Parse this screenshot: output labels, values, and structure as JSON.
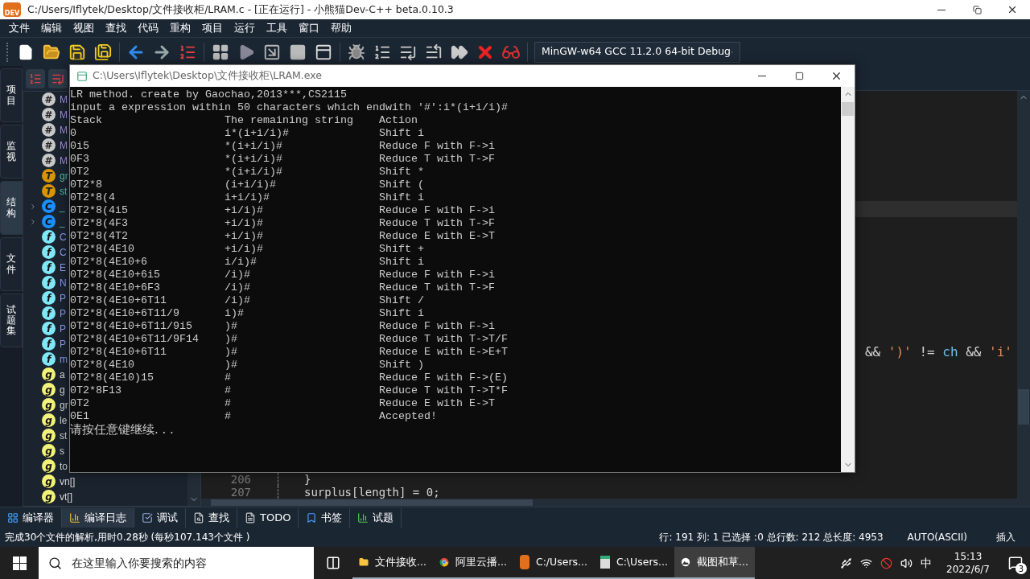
{
  "window": {
    "title": "C:/Users/Iflytek/Desktop/文件接收柜/LRAM.c - [正在运行] - 小熊猫Dev-C++ beta.0.10.3",
    "logo": "DEV"
  },
  "menu": [
    "文件",
    "编辑",
    "视图",
    "查找",
    "代码",
    "重构",
    "项目",
    "运行",
    "工具",
    "窗口",
    "帮助"
  ],
  "toolbar": {
    "compiler": "MinGW-w64 GCC 11.2.0 64-bit Debug"
  },
  "side_tabs": [
    {
      "label": "项目",
      "selected": false
    },
    {
      "label": "监视",
      "selected": false
    },
    {
      "label": "结构",
      "selected": true
    },
    {
      "label": "文件",
      "selected": false
    },
    {
      "label": "试题集",
      "selected": false
    }
  ],
  "structure": {
    "items": [
      {
        "kind": "define",
        "badge": "#",
        "name": "M"
      },
      {
        "kind": "define",
        "badge": "#",
        "name": "M"
      },
      {
        "kind": "define",
        "badge": "#",
        "name": "M"
      },
      {
        "kind": "define",
        "badge": "#",
        "name": "M"
      },
      {
        "kind": "define",
        "badge": "#",
        "name": "M"
      },
      {
        "kind": "type",
        "badge": "T",
        "name": "gr"
      },
      {
        "kind": "type",
        "badge": "T",
        "name": "st"
      },
      {
        "kind": "class",
        "badge": "C",
        "name": "_",
        "expanded": false
      },
      {
        "kind": "class",
        "badge": "C",
        "name": "_",
        "expanded": false
      },
      {
        "kind": "function",
        "badge": "f",
        "name": "C"
      },
      {
        "kind": "function",
        "badge": "f",
        "name": "C"
      },
      {
        "kind": "function",
        "badge": "f",
        "name": "E"
      },
      {
        "kind": "function",
        "badge": "f",
        "name": "N"
      },
      {
        "kind": "function",
        "badge": "f",
        "name": "P"
      },
      {
        "kind": "function",
        "badge": "f",
        "name": "P"
      },
      {
        "kind": "function",
        "badge": "f",
        "name": "P"
      },
      {
        "kind": "function",
        "badge": "f",
        "name": "P"
      },
      {
        "kind": "function",
        "badge": "f",
        "name": "m"
      },
      {
        "kind": "global",
        "badge": "g",
        "name": "a"
      },
      {
        "kind": "global",
        "badge": "g",
        "name": "g"
      },
      {
        "kind": "global",
        "badge": "g",
        "name": "gr"
      },
      {
        "kind": "global",
        "badge": "g",
        "name": "le"
      },
      {
        "kind": "global",
        "badge": "g",
        "name": "st"
      },
      {
        "kind": "global",
        "badge": "g",
        "name": "s"
      },
      {
        "kind": "global",
        "badge": "g",
        "name": "to"
      },
      {
        "kind": "global",
        "badge": "g",
        "name": "vn[]"
      },
      {
        "kind": "global",
        "badge": "g",
        "name": "vt[]"
      }
    ]
  },
  "editor": {
    "fragment": [
      {
        "text": "&&",
        "kind": "op"
      },
      {
        "text": "')'",
        "kind": "str"
      },
      {
        "text": "!=",
        "kind": "op"
      },
      {
        "text": "ch",
        "kind": "id"
      },
      {
        "text": "&&",
        "kind": "op"
      },
      {
        "text": "'i'",
        "kind": "str"
      }
    ],
    "lines": [
      {
        "number": "206",
        "code": "}"
      },
      {
        "number": "207",
        "code": "surplus[length] = 0;"
      }
    ]
  },
  "console": {
    "title": "C:\\Users\\Iflytek\\Desktop\\文件接收柜\\LRAM.exe",
    "intro": [
      "LR method. create by Gaochao,2013***,CS2115",
      "input a expression within 50 characters which endwith '#':i*(i+i/i)#"
    ],
    "columns": [
      "Stack",
      "The remaining string",
      "Action"
    ],
    "rows": [
      {
        "stack": "0",
        "remaining": "i*(i+i/i)#",
        "action": "Shift i"
      },
      {
        "stack": "0i5",
        "remaining": "*(i+i/i)#",
        "action": "Reduce F with F->i"
      },
      {
        "stack": "0F3",
        "remaining": "*(i+i/i)#",
        "action": "Reduce T with T->F"
      },
      {
        "stack": "0T2",
        "remaining": "*(i+i/i)#",
        "action": "Shift *"
      },
      {
        "stack": "0T2*8",
        "remaining": "(i+i/i)#",
        "action": "Shift ("
      },
      {
        "stack": "0T2*8(4",
        "remaining": "i+i/i)#",
        "action": "Shift i"
      },
      {
        "stack": "0T2*8(4i5",
        "remaining": "+i/i)#",
        "action": "Reduce F with F->i"
      },
      {
        "stack": "0T2*8(4F3",
        "remaining": "+i/i)#",
        "action": "Reduce T with T->F"
      },
      {
        "stack": "0T2*8(4T2",
        "remaining": "+i/i)#",
        "action": "Reduce E with E->T"
      },
      {
        "stack": "0T2*8(4E10",
        "remaining": "+i/i)#",
        "action": "Shift +"
      },
      {
        "stack": "0T2*8(4E10+6",
        "remaining": "i/i)#",
        "action": "Shift i"
      },
      {
        "stack": "0T2*8(4E10+6i5",
        "remaining": "/i)#",
        "action": "Reduce F with F->i"
      },
      {
        "stack": "0T2*8(4E10+6F3",
        "remaining": "/i)#",
        "action": "Reduce T with T->F"
      },
      {
        "stack": "0T2*8(4E10+6T11",
        "remaining": "/i)#",
        "action": "Shift /"
      },
      {
        "stack": "0T2*8(4E10+6T11/9",
        "remaining": "i)#",
        "action": "Shift i"
      },
      {
        "stack": "0T2*8(4E10+6T11/9i5",
        "remaining": ")#",
        "action": "Reduce F with F->i"
      },
      {
        "stack": "0T2*8(4E10+6T11/9F14",
        "remaining": ")#",
        "action": "Reduce T with T->T/F"
      },
      {
        "stack": "0T2*8(4E10+6T11",
        "remaining": ")#",
        "action": "Reduce E with E->E+T"
      },
      {
        "stack": "0T2*8(4E10",
        "remaining": ")#",
        "action": "Shift )"
      },
      {
        "stack": "0T2*8(4E10)15",
        "remaining": "#",
        "action": "Reduce F with F->(E)"
      },
      {
        "stack": "0T2*8F13",
        "remaining": "#",
        "action": "Reduce T with T->T*F"
      },
      {
        "stack": "0T2",
        "remaining": "#",
        "action": "Reduce E with E->T"
      },
      {
        "stack": "0E1",
        "remaining": "#",
        "action": "Accepted!"
      }
    ],
    "prompt": "请按任意键继续. . ."
  },
  "bottom_tabs": [
    {
      "label": "编译器",
      "kind": "compiler",
      "selected": false
    },
    {
      "label": "编译日志",
      "kind": "log",
      "selected": true
    },
    {
      "label": "调试",
      "kind": "debug",
      "selected": false
    },
    {
      "label": "查找",
      "kind": "find",
      "selected": false
    },
    {
      "label": "TODO",
      "kind": "todo",
      "selected": false
    },
    {
      "label": "书签",
      "kind": "bookmark",
      "selected": false
    },
    {
      "label": "试题",
      "kind": "problem",
      "selected": false
    }
  ],
  "status_bar": {
    "message": "完成30个文件的解析,用时0.28秒 (每秒107.143个文件 )",
    "position": "行: 191 列: 1 已选择 :0 总行数: 212 总长度: 4953",
    "encoding": "AUTO(ASCII)",
    "mode": "插入"
  },
  "taskbar": {
    "search_placeholder": "在这里输入你要搜索的内容",
    "apps": [
      {
        "label": "文件接收...",
        "kind": "folder",
        "selected": false
      },
      {
        "label": "阿里云播...",
        "kind": "browser",
        "selected": false
      },
      {
        "label": "C:/Users...",
        "kind": "ide",
        "selected": false
      },
      {
        "label": "C:\\Users...",
        "kind": "console",
        "selected": false
      },
      {
        "label": "截图和草...",
        "kind": "snip",
        "selected": true
      }
    ],
    "ime": "中",
    "time": "15:13",
    "date": "2022/6/7",
    "notifications": "3"
  }
}
